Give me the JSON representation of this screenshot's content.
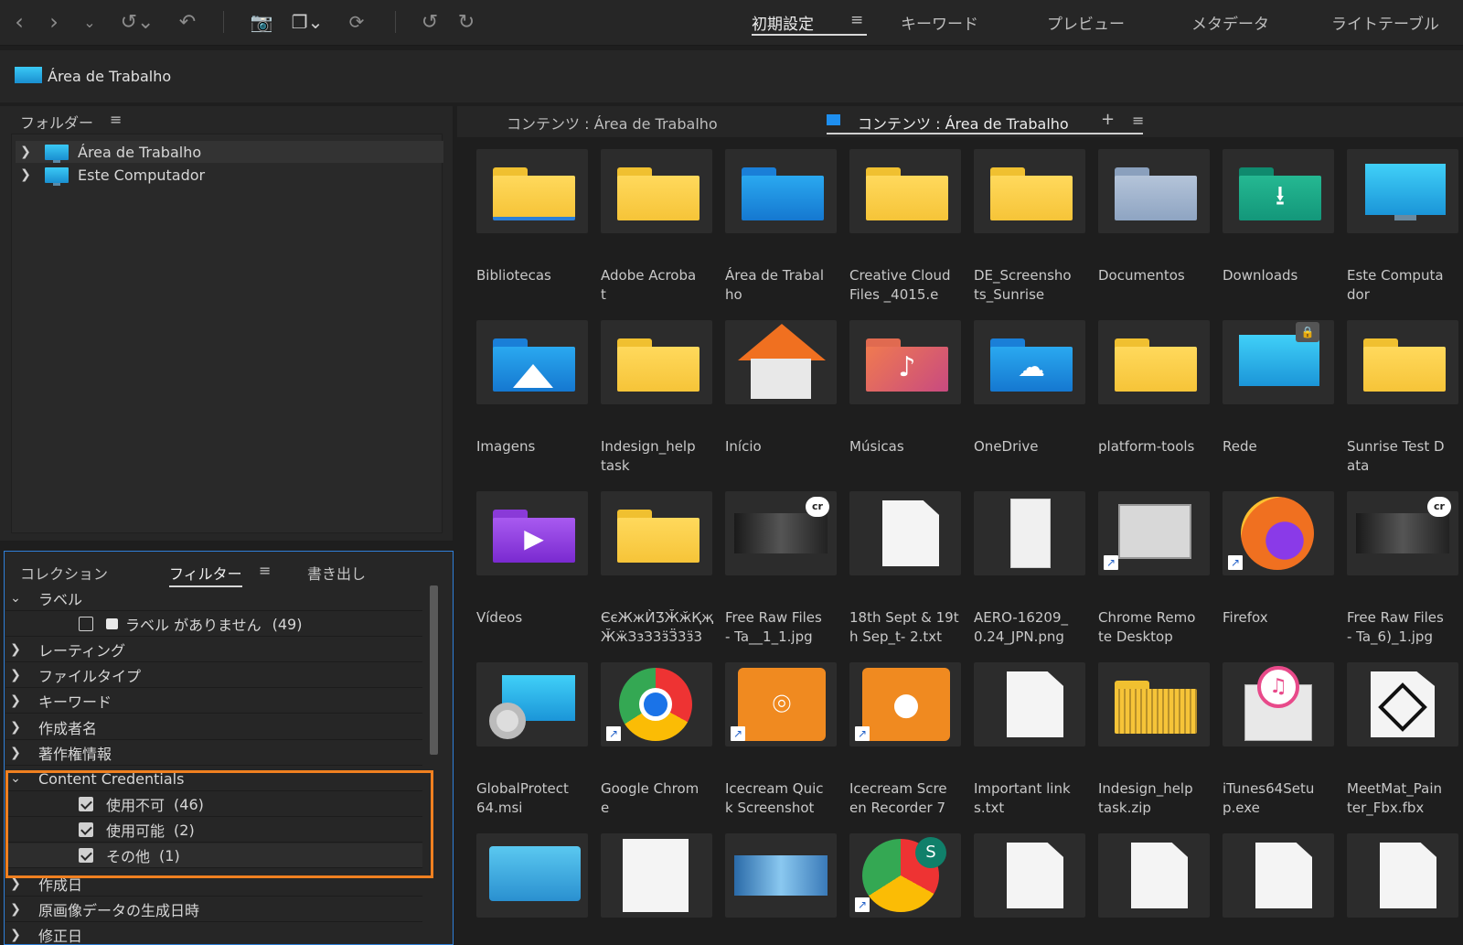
{
  "toolbar": {
    "workspaces": [
      "初期設定",
      "キーワード",
      "プレビュー",
      "メタデータ",
      "ライトテーブル"
    ],
    "active_workspace": "初期設定",
    "menu_glyph": "≡"
  },
  "path": {
    "label": "Área de Trabalho"
  },
  "folders_panel": {
    "title": "フォルダー",
    "items": [
      {
        "label": "Área de Trabalho"
      },
      {
        "label": "Este Computador"
      }
    ]
  },
  "bottom_panel": {
    "tabs": [
      "コレクション",
      "フィルター",
      "書き出し"
    ],
    "active_tab": "フィルター",
    "rows": [
      {
        "label": "ラベル",
        "expanded": true
      },
      {
        "label": "ラベル がありません",
        "count": "(49)",
        "checked": false
      },
      {
        "label": "レーティング"
      },
      {
        "label": "ファイルタイプ"
      },
      {
        "label": "キーワード"
      },
      {
        "label": "作成者名"
      },
      {
        "label": "著作権情報"
      },
      {
        "label": "Content Credentials",
        "expanded": true
      },
      {
        "label": "使用不可",
        "count": "(46)",
        "checked": true
      },
      {
        "label": "使用可能",
        "count": "(2)",
        "checked": true
      },
      {
        "label": "その他",
        "count": "(1)",
        "checked": true
      },
      {
        "label": "作成日"
      },
      {
        "label": "原画像データの生成日時"
      },
      {
        "label": "修正日"
      }
    ]
  },
  "content": {
    "tab1": "コンテンツ : Área de Trabalho",
    "tab2": "コンテンツ : Área de Trabalho",
    "add_glyph": "+",
    "items": [
      [
        "Bibliotecas",
        ""
      ],
      [
        "Adobe Acroba",
        "t"
      ],
      [
        "Área de Trabal",
        "ho"
      ],
      [
        "Creative Cloud",
        "Files _4015.e"
      ],
      [
        "DE_Screensho",
        "ts_Sunrise"
      ],
      [
        "Documentos",
        ""
      ],
      [
        "Downloads",
        ""
      ],
      [
        "Este Computa",
        "dor"
      ],
      [
        "Imagens",
        ""
      ],
      [
        "Indesign_help",
        "task"
      ],
      [
        "Início",
        ""
      ],
      [
        "Músicas",
        ""
      ],
      [
        "OneDrive",
        ""
      ],
      [
        "platform-tools",
        ""
      ],
      [
        "Rede",
        ""
      ],
      [
        "Sunrise Test D",
        "ata"
      ],
      [
        "Vídeos",
        ""
      ],
      [
        "ЄєЖжЍӠӁӂҚҗ",
        "ӁӝЗзЗ3ӟӞ3ӟ3"
      ],
      [
        "Free Raw Files",
        "- Ta__1_1.jpg"
      ],
      [
        "18th Sept & 19t",
        "h Sep_t- 2.txt"
      ],
      [
        "AERO-16209_",
        "0.24_JPN.png"
      ],
      [
        "Chrome Remo",
        "te Desktop"
      ],
      [
        "Firefox",
        ""
      ],
      [
        "Free Raw Files",
        "- Ta_6)_1.jpg"
      ],
      [
        "GlobalProtect",
        "64.msi"
      ],
      [
        "Google Chrom",
        "e"
      ],
      [
        "Icecream Quic",
        "k Screenshot"
      ],
      [
        "Icecream Scre",
        "en Recorder 7"
      ],
      [
        "Important link",
        "s.txt"
      ],
      [
        "Indesign_help",
        "task.zip"
      ],
      [
        "iTunes64Setu",
        "p.exe"
      ],
      [
        "MeetMat_Pain",
        "ter_Fbx.fbx"
      ]
    ]
  }
}
